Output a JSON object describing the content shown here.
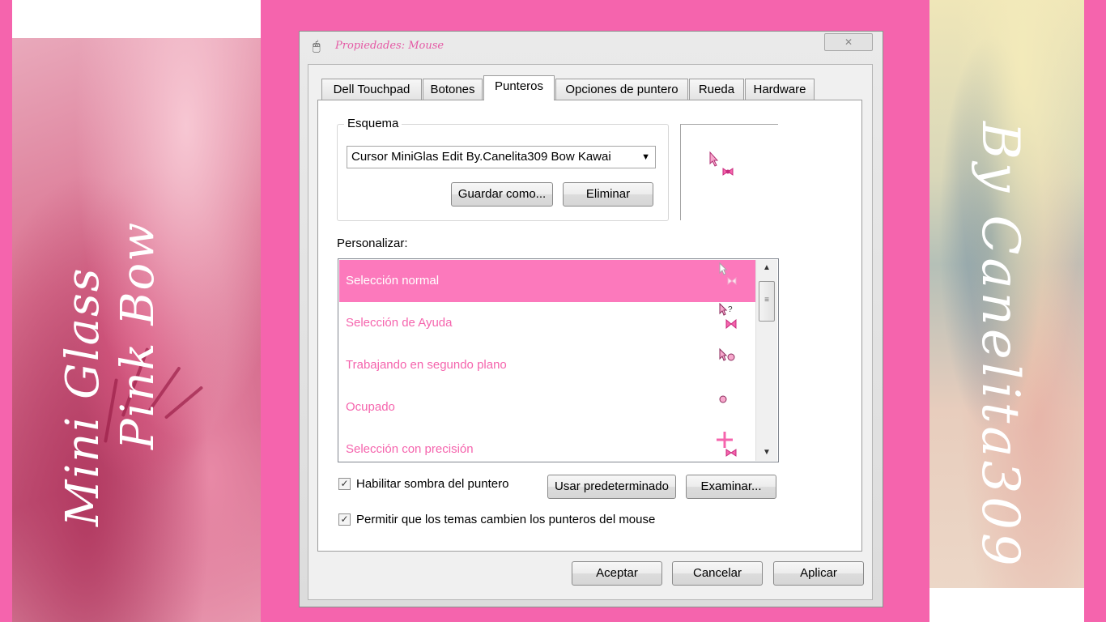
{
  "left_panel": {
    "line1": "Mini Glass",
    "line2": "Pink Bow"
  },
  "right_panel": {
    "text": "By Canelita309"
  },
  "window": {
    "title": "Propiedades: Mouse",
    "close_symbol": "✕",
    "tabs": [
      "Dell Touchpad",
      "Botones",
      "Punteros",
      "Opciones de puntero",
      "Rueda",
      "Hardware"
    ],
    "active_tab": "Punteros",
    "scheme": {
      "group_label": "Esquema",
      "selected": "Cursor MiniGlas Edit By.Canelita309 Bow Kawai",
      "save_as_label": "Guardar como...",
      "delete_label": "Eliminar"
    },
    "customize_label": "Personalizar:",
    "cursor_list": [
      {
        "label": "Selección normal",
        "icon": "arrow-bow-icon",
        "selected": true
      },
      {
        "label": "Selección de Ayuda",
        "icon": "help-bow-icon",
        "selected": false
      },
      {
        "label": "Trabajando en segundo plano",
        "icon": "arrow-busy-icon",
        "selected": false
      },
      {
        "label": "Ocupado",
        "icon": "busy-dot-icon",
        "selected": false
      },
      {
        "label": "Selección con precisión",
        "icon": "crosshair-bow-icon",
        "selected": false
      }
    ],
    "enable_shadow": {
      "label": "Habilitar sombra del puntero",
      "checked": true
    },
    "use_default_label": "Usar predeterminado",
    "browse_label": "Examinar...",
    "allow_themes": {
      "label": "Permitir que los temas cambien los punteros del mouse",
      "checked": true
    },
    "buttons": {
      "ok": "Aceptar",
      "cancel": "Cancelar",
      "apply": "Aplicar"
    }
  },
  "colors": {
    "background_pink": "#f564ad",
    "selection_pink": "#fc79bc",
    "list_text_pink": "#f564ad"
  }
}
